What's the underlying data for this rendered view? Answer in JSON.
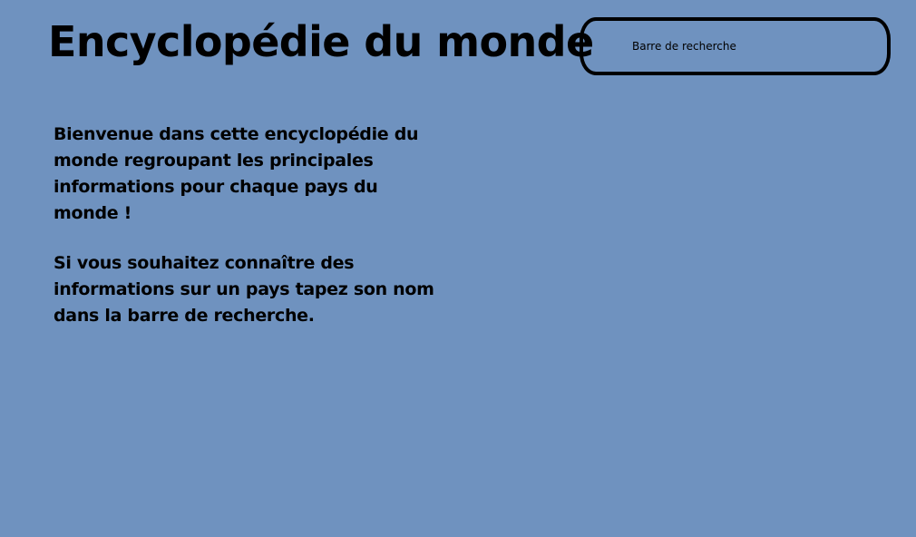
{
  "header": {
    "title": "Encyclopédie du monde"
  },
  "search": {
    "placeholder": "Barre de recherche",
    "value": ""
  },
  "intro": {
    "paragraphs": [
      "Bienvenue dans cette encyclopédie du monde regroupant les principales informations pour chaque pays du monde !",
      "Si vous souhaitez connaître des informations sur un pays tapez son nom dans la barre de recherche."
    ]
  },
  "colors": {
    "background": "#6f92bf",
    "text": "#000000",
    "search_border": "#000000"
  }
}
